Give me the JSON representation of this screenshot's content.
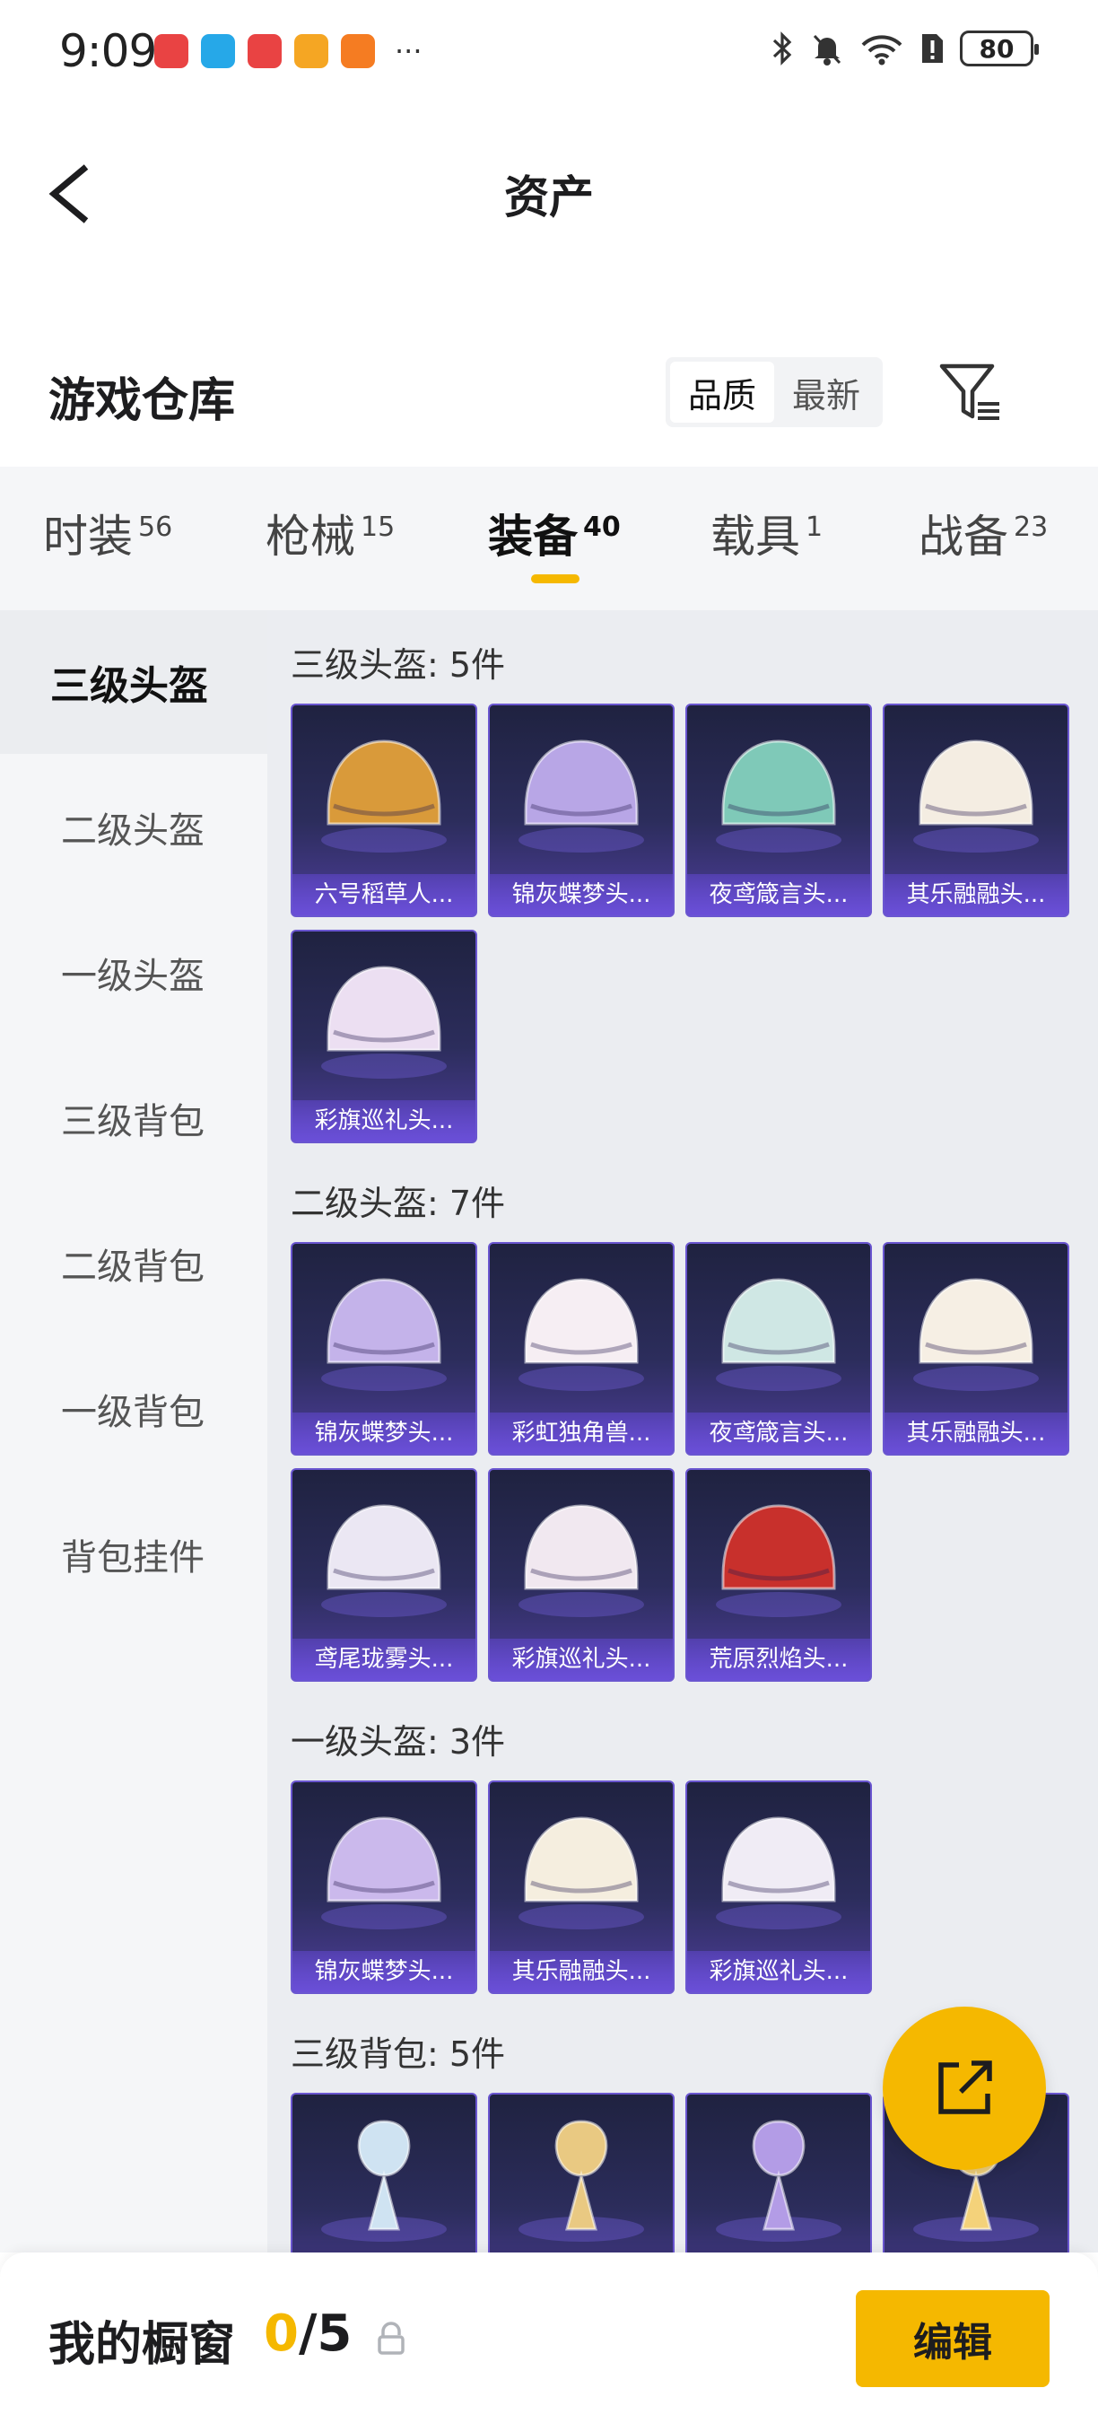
{
  "status_bar": {
    "time": "9:09",
    "battery": "80",
    "app_icon_colors": [
      "#e94343",
      "#26a8e8",
      "#e94343",
      "#f5a623",
      "#f57c22"
    ],
    "overflow": "···"
  },
  "navbar": {
    "title": "资产",
    "back_icon": "chevron-left-icon"
  },
  "warehouse": {
    "title": "游戏仓库",
    "sort_options": [
      "品质",
      "最新"
    ],
    "active_sort": "品质",
    "filter_icon": "filter-icon"
  },
  "tabs": [
    {
      "label": "时装",
      "count": "56",
      "active": false
    },
    {
      "label": "枪械",
      "count": "15",
      "active": false
    },
    {
      "label": "装备",
      "count": "40",
      "active": true
    },
    {
      "label": "载具",
      "count": "1",
      "active": false
    },
    {
      "label": "战备",
      "count": "23",
      "active": false
    }
  ],
  "sidebar": {
    "items": [
      {
        "label": "三级头盔",
        "active": true
      },
      {
        "label": "二级头盔",
        "active": false
      },
      {
        "label": "一级头盔",
        "active": false
      },
      {
        "label": "三级背包",
        "active": false
      },
      {
        "label": "二级背包",
        "active": false
      },
      {
        "label": "一级背包",
        "active": false
      },
      {
        "label": "背包挂件",
        "active": false
      }
    ]
  },
  "sections": [
    {
      "title": "三级头盔: 5件",
      "items": [
        {
          "name": "六号稻草人...",
          "art": "helmet-icon",
          "color": "#d99a3a"
        },
        {
          "name": "锦灰蝶梦头...",
          "art": "helmet-icon",
          "color": "#b8a6e6"
        },
        {
          "name": "夜鸢箴言头...",
          "art": "helmet-icon",
          "color": "#7fc9b8"
        },
        {
          "name": "其乐融融头...",
          "art": "helmet-icon",
          "color": "#f4ede2"
        },
        {
          "name": "彩旗巡礼头...",
          "art": "helmet-icon",
          "color": "#ecdff2"
        }
      ]
    },
    {
      "title": "二级头盔: 7件",
      "items": [
        {
          "name": "锦灰蝶梦头...",
          "art": "helmet-icon",
          "color": "#c4b3ea"
        },
        {
          "name": "彩虹独角兽...",
          "art": "helmet-icon",
          "color": "#f6eef3"
        },
        {
          "name": "夜鸢箴言头...",
          "art": "helmet-icon",
          "color": "#cfe7e4"
        },
        {
          "name": "其乐融融头...",
          "art": "helmet-icon",
          "color": "#f6efe4"
        },
        {
          "name": "鸢尾珑雾头...",
          "art": "helmet-icon",
          "color": "#ebe7f3"
        },
        {
          "name": "彩旗巡礼头...",
          "art": "helmet-icon",
          "color": "#f1e8f0"
        },
        {
          "name": "荒原烈焰头...",
          "art": "helmet-icon",
          "color": "#c8302c"
        }
      ]
    },
    {
      "title": "一级头盔: 3件",
      "items": [
        {
          "name": "锦灰蝶梦头...",
          "art": "helmet-icon",
          "color": "#cbb9ec"
        },
        {
          "name": "其乐融融头...",
          "art": "helmet-icon",
          "color": "#f5eedf"
        },
        {
          "name": "彩旗巡礼头...",
          "art": "helmet-icon",
          "color": "#f0ecf5"
        }
      ]
    },
    {
      "title": "三级背包: 5件",
      "items": [
        {
          "name": "",
          "art": "backpack-pendant-icon",
          "color": "#cfe3f2"
        },
        {
          "name": "",
          "art": "backpack-pendant-icon",
          "color": "#e9c982"
        },
        {
          "name": "",
          "art": "backpack-pendant-icon",
          "color": "#b39ce6"
        },
        {
          "name": "",
          "art": "backpack-pendant-icon",
          "color": "#f4d27a"
        }
      ]
    }
  ],
  "share_icon": "share-icon",
  "bottom_bar": {
    "label": "我的橱窗",
    "used": "0",
    "separator": "/",
    "total": "5",
    "lock_icon": "lock-icon",
    "edit_label": "编辑"
  },
  "colors": {
    "accent": "#f5b800",
    "card_border": "#6a56d0",
    "card_name_bg": "#6a4fd8"
  }
}
